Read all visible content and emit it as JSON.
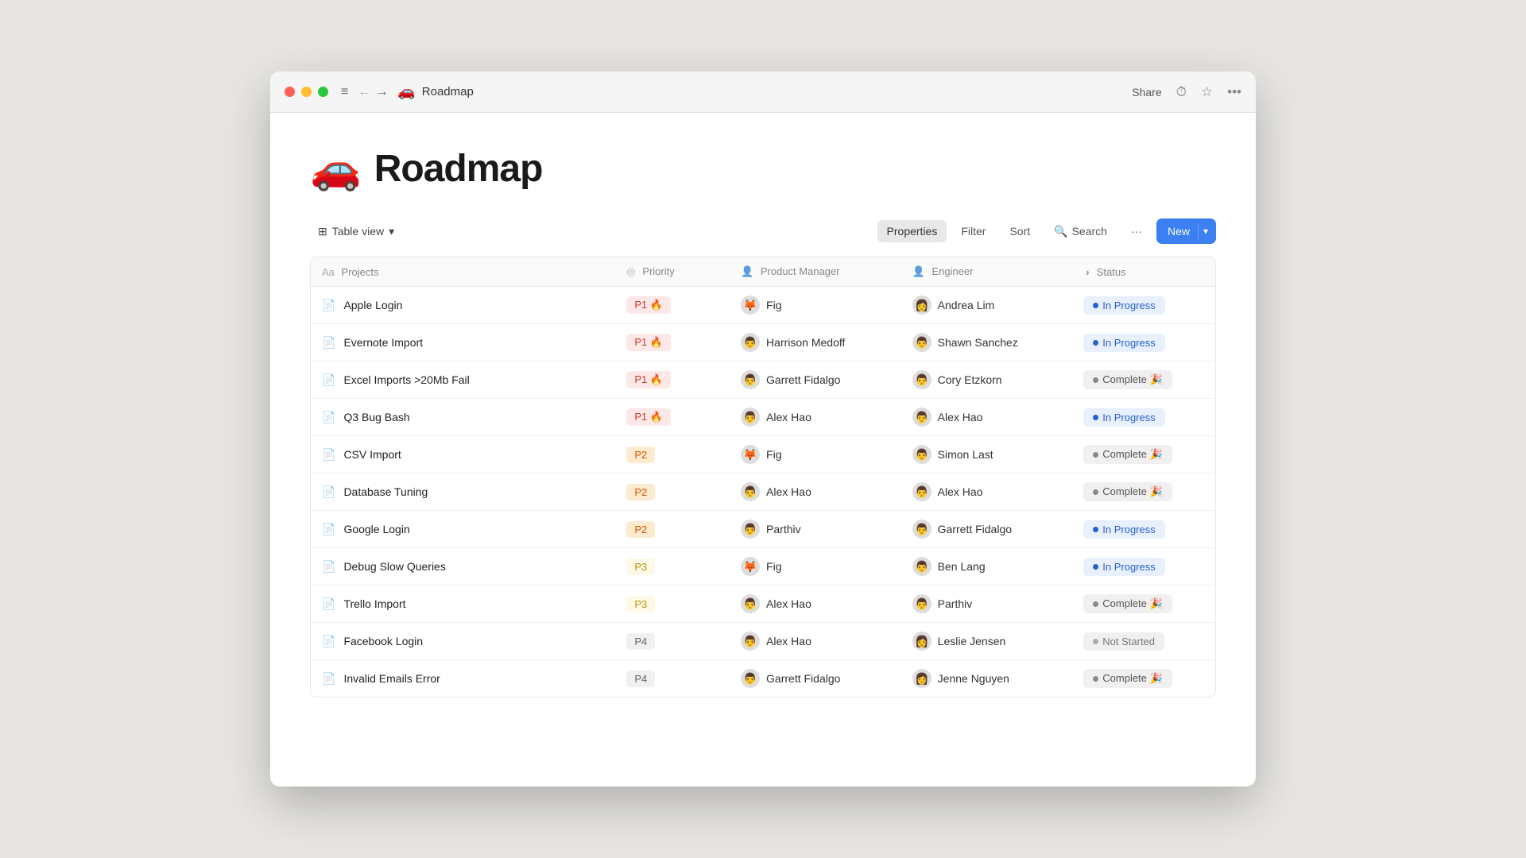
{
  "window": {
    "title": "Roadmap"
  },
  "titlebar": {
    "share": "Share",
    "menu_icon": "≡",
    "back_icon": "←",
    "forward_icon": "→",
    "page_emoji": "🚗",
    "page_title": "Roadmap",
    "history_icon": "⏱",
    "star_icon": "☆",
    "more_icon": "•••"
  },
  "page": {
    "emoji": "🚗",
    "title": "Roadmap"
  },
  "toolbar": {
    "view_label": "Table view",
    "view_icon": "⊞",
    "properties_label": "Properties",
    "filter_label": "Filter",
    "sort_label": "Sort",
    "search_label": "Search",
    "more_label": "···",
    "new_label": "New"
  },
  "table": {
    "columns": [
      {
        "key": "projects",
        "label": "Projects",
        "icon": "Aa"
      },
      {
        "key": "priority",
        "label": "Priority",
        "icon": "◎"
      },
      {
        "key": "product_manager",
        "label": "Product Manager",
        "icon": "👤"
      },
      {
        "key": "engineer",
        "label": "Engineer",
        "icon": "👤"
      },
      {
        "key": "status",
        "label": "Status",
        "icon": "◑"
      }
    ],
    "rows": [
      {
        "project": "Apple Login",
        "priority": "P1",
        "priority_level": "p1",
        "pm": "Fig",
        "pm_avatar": "🦊",
        "engineer": "Andrea Lim",
        "eng_avatar": "👩",
        "status": "In Progress",
        "status_key": "in-progress"
      },
      {
        "project": "Evernote Import",
        "priority": "P1",
        "priority_level": "p1",
        "pm": "Harrison Medoff",
        "pm_avatar": "👨",
        "engineer": "Shawn Sanchez",
        "eng_avatar": "👨",
        "status": "In Progress",
        "status_key": "in-progress"
      },
      {
        "project": "Excel Imports >20Mb Fail",
        "priority": "P1",
        "priority_level": "p1",
        "pm": "Garrett Fidalgo",
        "pm_avatar": "👨",
        "engineer": "Cory Etzkorn",
        "eng_avatar": "👨",
        "status": "Complete 🎉",
        "status_key": "complete"
      },
      {
        "project": "Q3 Bug Bash",
        "priority": "P1",
        "priority_level": "p1",
        "pm": "Alex Hao",
        "pm_avatar": "👨",
        "engineer": "Alex Hao",
        "eng_avatar": "👨",
        "status": "In Progress",
        "status_key": "in-progress"
      },
      {
        "project": "CSV Import",
        "priority": "P2",
        "priority_level": "p2",
        "pm": "Fig",
        "pm_avatar": "🦊",
        "engineer": "Simon Last",
        "eng_avatar": "👨",
        "status": "Complete 🎉",
        "status_key": "complete"
      },
      {
        "project": "Database Tuning",
        "priority": "P2",
        "priority_level": "p2",
        "pm": "Alex Hao",
        "pm_avatar": "👨",
        "engineer": "Alex Hao",
        "eng_avatar": "👨",
        "status": "Complete 🎉",
        "status_key": "complete"
      },
      {
        "project": "Google Login",
        "priority": "P2",
        "priority_level": "p2",
        "pm": "Parthiv",
        "pm_avatar": "👨",
        "engineer": "Garrett Fidalgo",
        "eng_avatar": "👨",
        "status": "In Progress",
        "status_key": "in-progress"
      },
      {
        "project": "Debug Slow Queries",
        "priority": "P3",
        "priority_level": "p3",
        "pm": "Fig",
        "pm_avatar": "🦊",
        "engineer": "Ben Lang",
        "eng_avatar": "👨",
        "status": "In Progress",
        "status_key": "in-progress"
      },
      {
        "project": "Trello Import",
        "priority": "P3",
        "priority_level": "p3",
        "pm": "Alex Hao",
        "pm_avatar": "👨",
        "engineer": "Parthiv",
        "eng_avatar": "👨",
        "status": "Complete 🎉",
        "status_key": "complete"
      },
      {
        "project": "Facebook Login",
        "priority": "P4",
        "priority_level": "p4",
        "pm": "Alex Hao",
        "pm_avatar": "👨",
        "engineer": "Leslie Jensen",
        "eng_avatar": "👩",
        "status": "Not Started",
        "status_key": "not-started"
      },
      {
        "project": "Invalid Emails Error",
        "priority": "P4",
        "priority_level": "p4",
        "pm": "Garrett Fidalgo",
        "pm_avatar": "👨",
        "engineer": "Jenne Nguyen",
        "eng_avatar": "👩",
        "status": "Complete 🎉",
        "status_key": "complete"
      }
    ]
  }
}
